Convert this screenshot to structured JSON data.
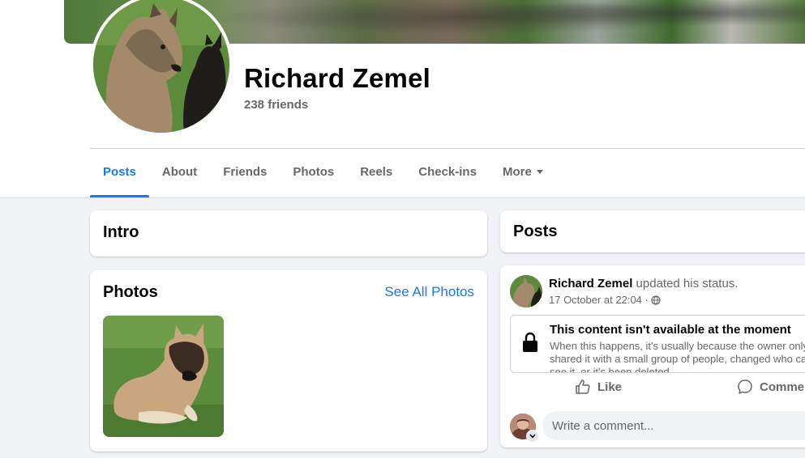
{
  "profile": {
    "name": "Richard Zemel",
    "friends": "238 friends"
  },
  "tabs": [
    {
      "label": "Posts",
      "active": true
    },
    {
      "label": "About"
    },
    {
      "label": "Friends"
    },
    {
      "label": "Photos"
    },
    {
      "label": "Reels"
    },
    {
      "label": "Check-ins"
    },
    {
      "label": "More"
    }
  ],
  "intro": {
    "title": "Intro"
  },
  "photos": {
    "title": "Photos",
    "see_all": "See All Photos"
  },
  "posts": {
    "title": "Posts",
    "post": {
      "author": "Richard Zemel",
      "action": "updated his status.",
      "time": "17 October at 22:04 ·",
      "unavailable_title": "This content isn't available at the moment",
      "unavailable_desc": "When this happens, it's usually because the owner only shared it with a small group of people, changed who can see it, or it's been deleted.",
      "like_label": "Like",
      "comment_label": "Comment",
      "comment_placeholder": "Write a comment..."
    }
  },
  "colors": {
    "accent": "#1877f2",
    "secondary_text": "#65676b",
    "page_bg": "#f0f2f5"
  },
  "icons": {
    "caret": "caret-down-icon",
    "globe": "globe-icon",
    "lock": "lock-icon",
    "like": "thumbs-up-icon",
    "comment": "speech-bubble-icon"
  }
}
